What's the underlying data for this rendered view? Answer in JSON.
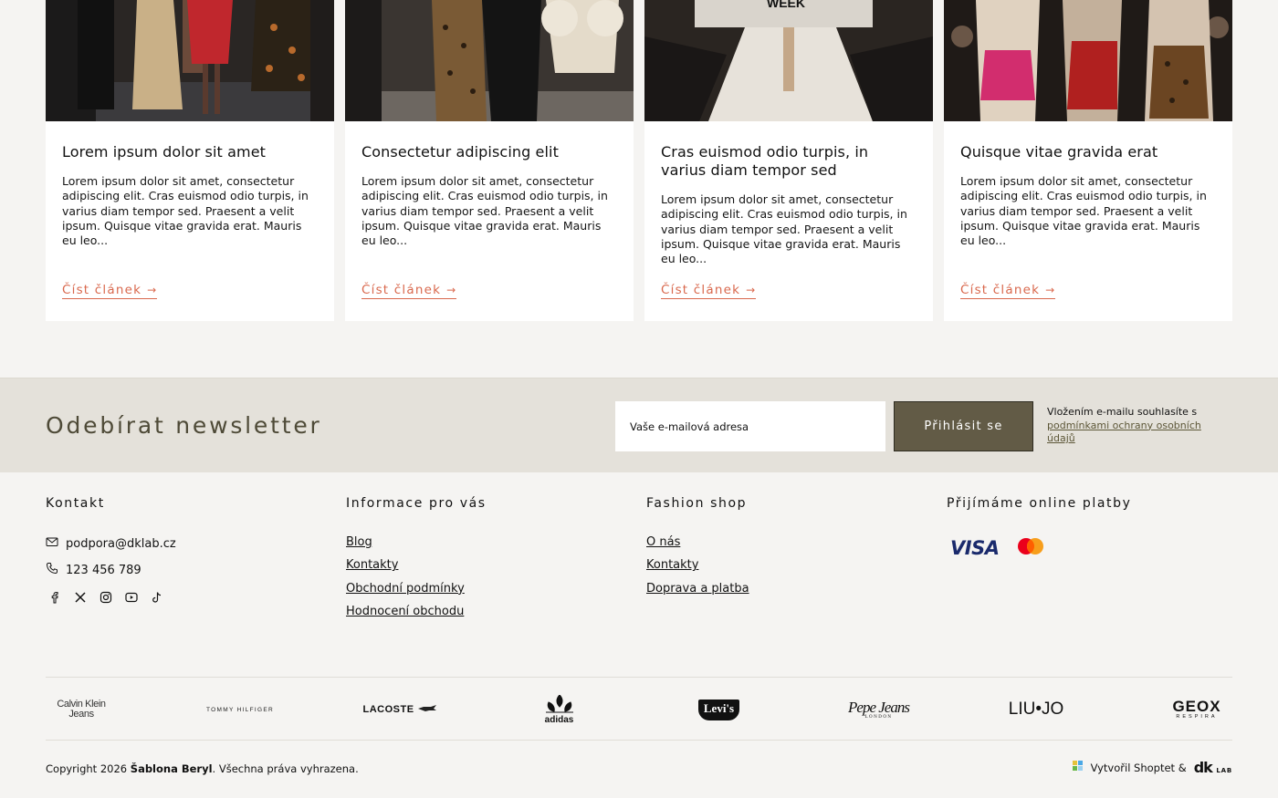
{
  "articles": {
    "read_more": "Číst článek",
    "items": [
      {
        "title": "Lorem ipsum dolor sit amet",
        "excerpt": "Lorem ipsum dolor sit amet, consectetur adipiscing elit. Cras euismod odio turpis, in varius diam tempor sed. Praesent a velit ipsum. Quisque vitae gravida erat. Mauris eu leo..."
      },
      {
        "title": "Consectetur adipiscing elit",
        "excerpt": "Lorem ipsum dolor sit amet, consectetur adipiscing elit. Cras euismod odio turpis, in varius diam tempor sed. Praesent a velit ipsum. Quisque vitae gravida erat. Mauris eu leo..."
      },
      {
        "title": "Cras euismod odio turpis, in varius diam tempor sed",
        "excerpt": "Lorem ipsum dolor sit amet, consectetur adipiscing elit. Cras euismod odio turpis, in varius diam tempor sed. Praesent a velit ipsum. Quisque vitae gravida erat. Mauris eu leo...",
        "image_text": "WEEK"
      },
      {
        "title": "Quisque vitae gravida erat",
        "excerpt": "Lorem ipsum dolor sit amet, consectetur adipiscing elit. Cras euismod odio turpis, in varius diam tempor sed. Praesent a velit ipsum. Quisque vitae gravida erat. Mauris eu leo..."
      }
    ]
  },
  "newsletter": {
    "title": "Odebírat newsletter",
    "placeholder": "Vaše e-mailová adresa",
    "button": "Přihlásit se",
    "note_prefix": "Vložením e-mailu souhlasíte s",
    "note_link": "podmínkami ochrany osobních údajů"
  },
  "footer": {
    "contact": {
      "heading": "Kontakt",
      "email": "podpora@dklab.cz",
      "phone": "123 456 789",
      "socials": [
        "facebook-icon",
        "x-icon",
        "instagram-icon",
        "youtube-icon",
        "tiktok-icon"
      ]
    },
    "info": {
      "heading": "Informace pro vás",
      "links": [
        "Blog",
        "Kontakty",
        "Obchodní podmínky",
        "Hodnocení obchodu"
      ]
    },
    "shop": {
      "heading": "Fashion shop",
      "links": [
        "O nás",
        "Kontakty",
        "Doprava a platba"
      ]
    },
    "payments": {
      "heading": "Přijímáme online platby",
      "visa": "VISA"
    }
  },
  "brands": {
    "calvin": "Calvin Klein Jeans",
    "tommy": "TOMMY HILFIGER",
    "lacoste": "LACOSTE",
    "adidas": "adidas",
    "levis": "Levi's",
    "pepe": "Pepe Jeans",
    "pepe_sub": "LONDON",
    "liujo": "LIU•JO",
    "geox": "GEOX",
    "geox_sub": "RESPIRA"
  },
  "bottom": {
    "copyright_prefix": "Copyright 2026 ",
    "copyright_brand": "Šablona Beryl",
    "copyright_suffix": ". Všechna práva vyhrazena.",
    "credit": "Vytvořil Shoptet &",
    "dk": "dk",
    "lab": "LAB"
  },
  "colors": {
    "accent": "#d9684d",
    "olive": "#625b46",
    "newsletter_bg": "#e4e1da",
    "page_bg": "#f5f4f2"
  }
}
